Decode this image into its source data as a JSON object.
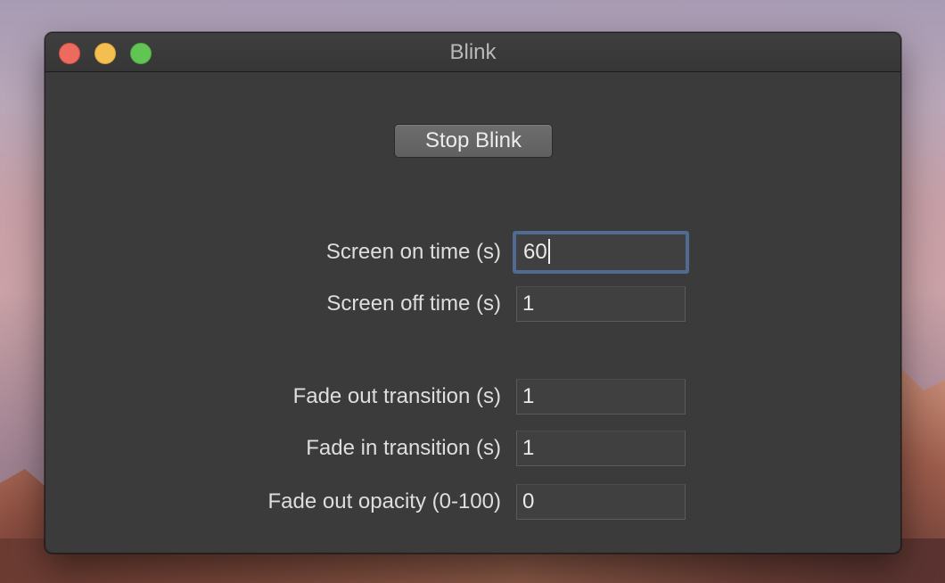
{
  "window": {
    "title": "Blink"
  },
  "controls": {
    "stop_button_label": "Stop Blink"
  },
  "fields": [
    {
      "label": "Screen on time (s)",
      "value": "60",
      "focused": true
    },
    {
      "label": "Screen off time (s)",
      "value": "1",
      "focused": false
    },
    {
      "label": "Fade out transition (s)",
      "value": "1",
      "focused": false
    },
    {
      "label": "Fade in transition (s)",
      "value": "1",
      "focused": false
    },
    {
      "label": "Fade out opacity (0-100)",
      "value": "0",
      "focused": false
    }
  ],
  "icons": {
    "close": "close-icon",
    "minimize": "minimize-icon",
    "zoom": "zoom-icon"
  },
  "colors": {
    "close": "#ed6a5e",
    "minimize": "#f5bf4f",
    "zoom": "#61c554",
    "focus_ring": "#4f6b94",
    "window_bg": "#3b3b3b"
  }
}
